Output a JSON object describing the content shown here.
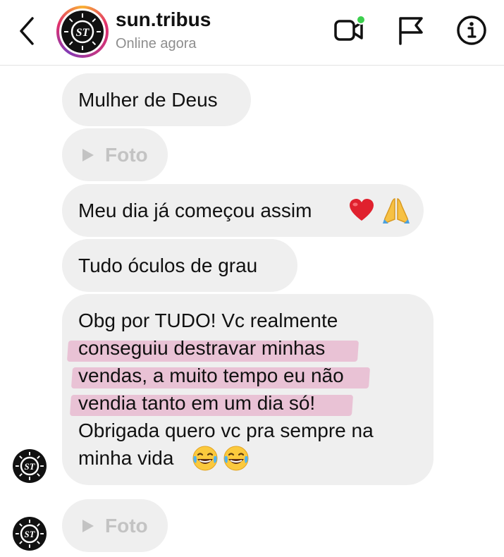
{
  "header": {
    "username": "sun.tribus",
    "status": "Online agora"
  },
  "messages": {
    "m1": "Mulher de Deus",
    "photo_label": "Foto",
    "m3": "Meu dia já começou assim",
    "m4": "Tudo óculos de grau",
    "m5_lines": [
      "Obg por TUDO! Vc realmente",
      "conseguiu destravar minhas",
      "vendas, a muito tempo eu não",
      "vendia tanto em um dia só!",
      "Obrigada quero vc pra sempre na",
      "minha vida"
    ]
  },
  "colors": {
    "bubble": "#efefef",
    "highlight": "#e078aa",
    "online_dot": "#3ccf4e"
  },
  "icons": [
    "back-chevron-icon",
    "video-call-icon",
    "flag-icon",
    "info-icon",
    "play-icon",
    "heart-emoji",
    "praying-hands-emoji",
    "laughing-emoji"
  ]
}
